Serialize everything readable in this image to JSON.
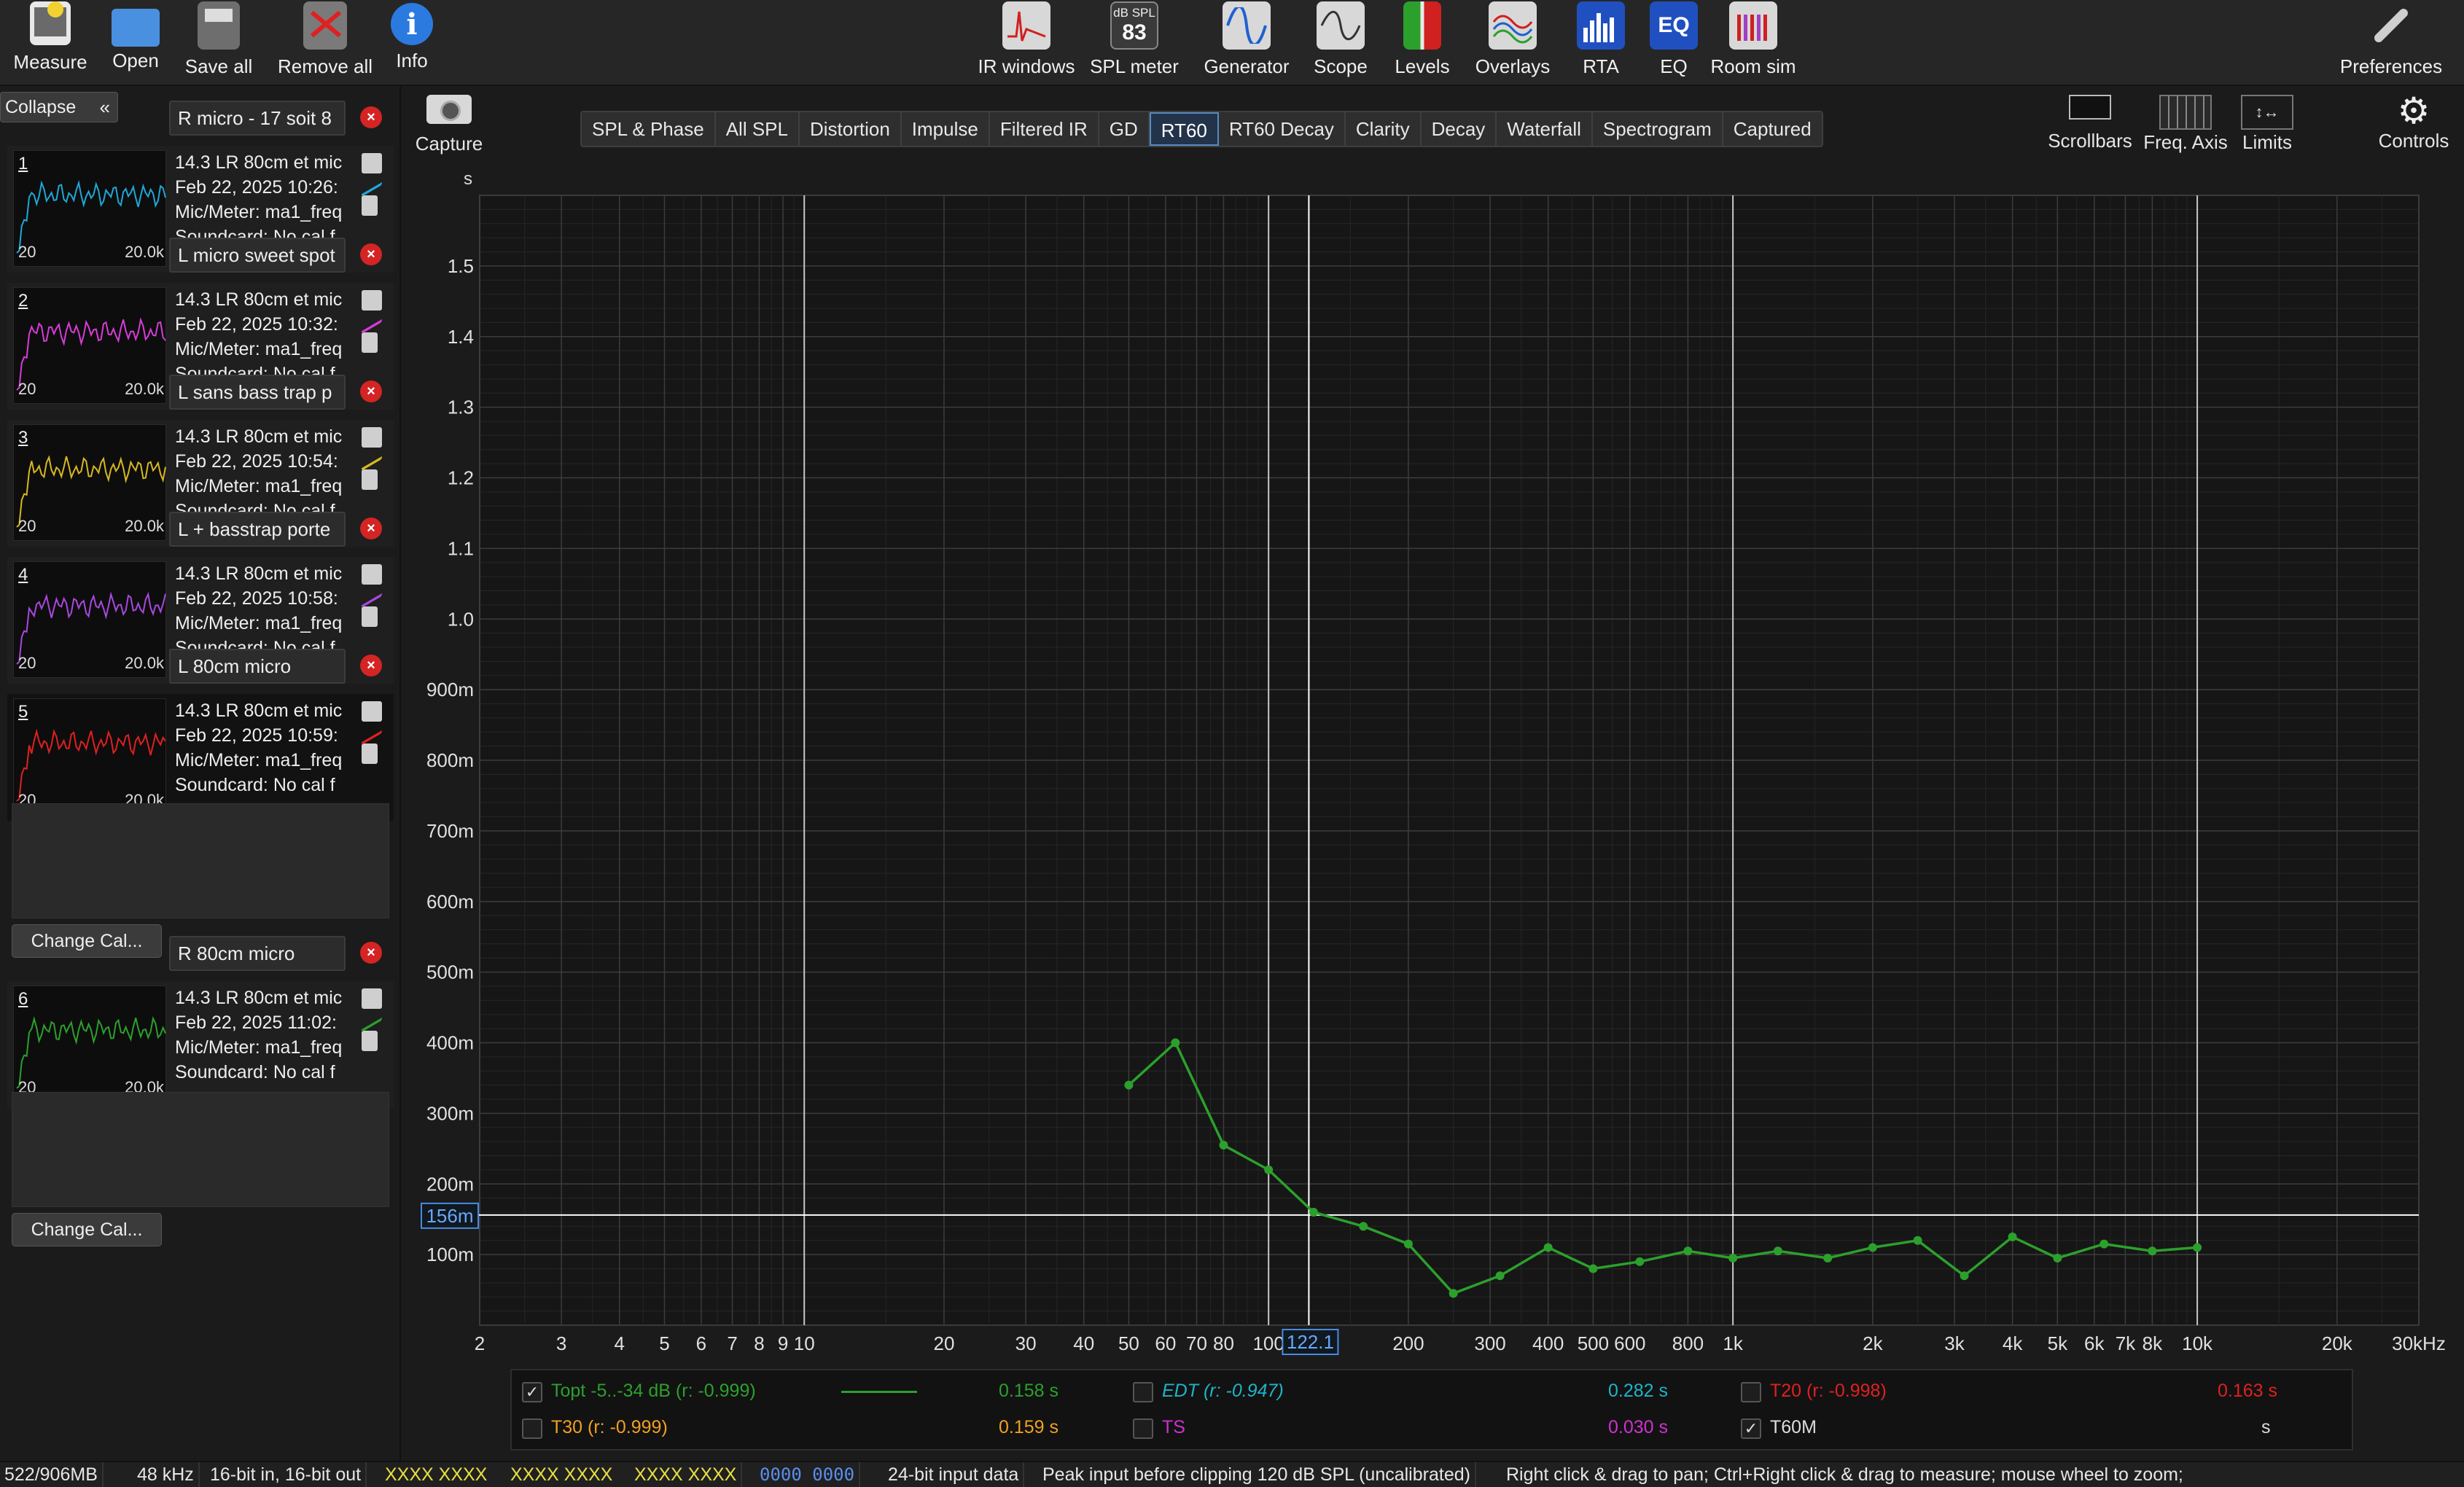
{
  "toolbar": {
    "left": [
      {
        "label": "Measure",
        "icon": "measure-icon"
      },
      {
        "label": "Open",
        "icon": "folder-icon"
      },
      {
        "label": "Save all",
        "icon": "save-icon"
      },
      {
        "label": "Remove all",
        "icon": "remove-icon"
      },
      {
        "label": "Info",
        "icon": "info-icon"
      }
    ],
    "center": [
      {
        "label": "IR windows",
        "icon": "ir-windows-icon"
      },
      {
        "label": "SPL meter",
        "icon": "spl-meter-icon",
        "badge_top": "dB SPL",
        "badge_value": "83"
      },
      {
        "label": "Generator",
        "icon": "generator-icon"
      },
      {
        "label": "Scope",
        "icon": "scope-icon"
      },
      {
        "label": "Levels",
        "icon": "levels-icon"
      },
      {
        "label": "Overlays",
        "icon": "overlays-icon"
      },
      {
        "label": "RTA",
        "icon": "rta-icon"
      },
      {
        "label": "EQ",
        "icon": "eq-icon",
        "badge_value": "EQ"
      },
      {
        "label": "Room sim",
        "icon": "room-sim-icon"
      }
    ],
    "right": {
      "label": "Preferences",
      "icon": "wrench-icon"
    }
  },
  "left_panel": {
    "collapse_label": "Collapse",
    "change_cal_label": "Change Cal...",
    "measurements": [
      {
        "num": "1",
        "name": "R micro - 17 soit 8",
        "line1": "14.3 LR 80cm et mic",
        "line2": "Feb 22, 2025 10:26:",
        "line3": "Mic/Meter: ma1_freq",
        "line4": "Soundcard: No cal f",
        "lo": "20",
        "hi": "20.0k",
        "color": "#1ea8d8"
      },
      {
        "num": "2",
        "name": "L micro sweet spot",
        "line1": "14.3 LR 80cm et mic",
        "line2": "Feb 22, 2025 10:32:",
        "line3": "Mic/Meter: ma1_freq",
        "line4": "Soundcard: No cal f",
        "lo": "20",
        "hi": "20.0k",
        "color": "#d83cd8"
      },
      {
        "num": "3",
        "name": "L sans bass trap p",
        "line1": "14.3 LR 80cm et mic",
        "line2": "Feb 22, 2025 10:54:",
        "line3": "Mic/Meter: ma1_freq",
        "line4": "Soundcard: No cal f",
        "lo": "20",
        "hi": "20.0k",
        "color": "#d8b820"
      },
      {
        "num": "4",
        "name": "L + basstrap porte",
        "line1": "14.3 LR 80cm et mic",
        "line2": "Feb 22, 2025 10:58:",
        "line3": "Mic/Meter: ma1_freq",
        "line4": "Soundcard: No cal f",
        "lo": "20",
        "hi": "20.0k",
        "color": "#a848e0"
      },
      {
        "num": "5",
        "name": "L 80cm micro",
        "line1": "14.3 LR 80cm et mic",
        "line2": "Feb 22, 2025 10:59:",
        "line3": "Mic/Meter: ma1_freq",
        "line4": "Soundcard: No cal f",
        "lo": "20",
        "hi": "20.0k",
        "color": "#e02020"
      },
      {
        "num": "6",
        "name": "R 80cm micro",
        "line1": "14.3 LR 80cm et mic",
        "line2": "Feb 22, 2025 11:02:",
        "line3": "Mic/Meter: ma1_freq",
        "line4": "Soundcard: No cal f",
        "lo": "20",
        "hi": "20.0k",
        "color": "#2ca02c"
      }
    ]
  },
  "capture_label": "Capture",
  "tabs": [
    "SPL & Phase",
    "All SPL",
    "Distortion",
    "Impulse",
    "Filtered IR",
    "GD",
    "RT60",
    "RT60 Decay",
    "Clarity",
    "Decay",
    "Waterfall",
    "Spectrogram",
    "Captured"
  ],
  "active_tab": "RT60",
  "right_tools": [
    {
      "label": "Scrollbars",
      "icon": "scrollbars-icon"
    },
    {
      "label": "Freq. Axis",
      "icon": "freq-axis-icon"
    },
    {
      "label": "Limits",
      "icon": "limits-icon"
    },
    {
      "label": "Controls",
      "icon": "gear-icon"
    }
  ],
  "chart_data": {
    "type": "line",
    "ylabel": "s",
    "xlim": [
      2,
      30000
    ],
    "ylim": [
      0.0,
      1.6
    ],
    "x_scale": "log",
    "x_ticks": [
      {
        "v": 2,
        "t": "2"
      },
      {
        "v": 3,
        "t": "3"
      },
      {
        "v": 4,
        "t": "4"
      },
      {
        "v": 5,
        "t": "5"
      },
      {
        "v": 6,
        "t": "6"
      },
      {
        "v": 7,
        "t": "7"
      },
      {
        "v": 8,
        "t": "8"
      },
      {
        "v": 9,
        "t": "9"
      },
      {
        "v": 10,
        "t": "10"
      },
      {
        "v": 20,
        "t": "20"
      },
      {
        "v": 30,
        "t": "30"
      },
      {
        "v": 40,
        "t": "40"
      },
      {
        "v": 50,
        "t": "50"
      },
      {
        "v": 60,
        "t": "60"
      },
      {
        "v": 70,
        "t": "70"
      },
      {
        "v": 80,
        "t": "80"
      },
      {
        "v": 100,
        "t": "100"
      },
      {
        "v": 200,
        "t": "200"
      },
      {
        "v": 300,
        "t": "300"
      },
      {
        "v": 400,
        "t": "400"
      },
      {
        "v": 500,
        "t": "500"
      },
      {
        "v": 600,
        "t": "600"
      },
      {
        "v": 800,
        "t": "800"
      },
      {
        "v": 1000,
        "t": "1k"
      },
      {
        "v": 2000,
        "t": "2k"
      },
      {
        "v": 3000,
        "t": "3k"
      },
      {
        "v": 4000,
        "t": "4k"
      },
      {
        "v": 5000,
        "t": "5k"
      },
      {
        "v": 6000,
        "t": "6k"
      },
      {
        "v": 7000,
        "t": "7k"
      },
      {
        "v": 8000,
        "t": "8k"
      },
      {
        "v": 10000,
        "t": "10k"
      },
      {
        "v": 20000,
        "t": "20k"
      },
      {
        "v": 30000,
        "t": "30kHz"
      }
    ],
    "y_ticks": [
      {
        "v": 1.5,
        "t": "1.5"
      },
      {
        "v": 1.4,
        "t": "1.4"
      },
      {
        "v": 1.3,
        "t": "1.3"
      },
      {
        "v": 1.2,
        "t": "1.2"
      },
      {
        "v": 1.1,
        "t": "1.1"
      },
      {
        "v": 1.0,
        "t": "1.0"
      },
      {
        "v": 0.9,
        "t": "900m"
      },
      {
        "v": 0.8,
        "t": "800m"
      },
      {
        "v": 0.7,
        "t": "700m"
      },
      {
        "v": 0.6,
        "t": "600m"
      },
      {
        "v": 0.5,
        "t": "500m"
      },
      {
        "v": 0.4,
        "t": "400m"
      },
      {
        "v": 0.3,
        "t": "300m"
      },
      {
        "v": 0.2,
        "t": "200m"
      },
      {
        "v": 0.1,
        "t": "100m"
      }
    ],
    "cursor": {
      "x": 122.1,
      "x_label": "122.1",
      "y": 0.156,
      "y_label": "156m"
    },
    "series": [
      {
        "color": "#2ca02c",
        "x": [
          50,
          63,
          80,
          100,
          125,
          160,
          200,
          250,
          315,
          400,
          500,
          630,
          800,
          1000,
          1250,
          1600,
          2000,
          2500,
          3150,
          4000,
          5000,
          6300,
          8000,
          10000
        ],
        "y": [
          0.34,
          0.4,
          0.255,
          0.22,
          0.16,
          0.14,
          0.115,
          0.045,
          0.07,
          0.11,
          0.08,
          0.09,
          0.105,
          0.095,
          0.105,
          0.095,
          0.11,
          0.12,
          0.07,
          0.125,
          0.095,
          0.115,
          0.105,
          0.11
        ]
      }
    ]
  },
  "legend": {
    "topt_label": "Topt -5..-34 dB (r: -0.999)",
    "topt_value": "0.158 s",
    "edt_label": "EDT (r: -0.947)",
    "edt_value": "0.282 s",
    "t20_label": "T20 (r: -0.998)",
    "t20_value": "0.163 s",
    "t30_label": "T30 (r: -0.999)",
    "t30_value": "0.159 s",
    "ts_label": "TS",
    "ts_value": "0.030 s",
    "t60m_label": "T60M",
    "t60m_value": "s",
    "check": "✓",
    "colors": {
      "topt": "#2ca02c",
      "edt": "#1eb4c8",
      "t20": "#e02020",
      "t30": "#f0a020",
      "ts": "#d030d0",
      "t60m": "#dddddd"
    }
  },
  "status": {
    "memory": "522/906MB",
    "rate": "48 kHz",
    "bits": "16-bit in, 16-bit out",
    "levels1": "XXXX XXXX",
    "levels2": "XXXX XXXX",
    "levels3": "XXXX XXXX",
    "levels4": "0000 0000",
    "input": "24-bit input data",
    "peak": "Peak input before clipping 120 dB SPL (uncalibrated)",
    "hint": "Right click & drag to pan; Ctrl+Right click & drag to measure; mouse wheel to zoom;"
  }
}
